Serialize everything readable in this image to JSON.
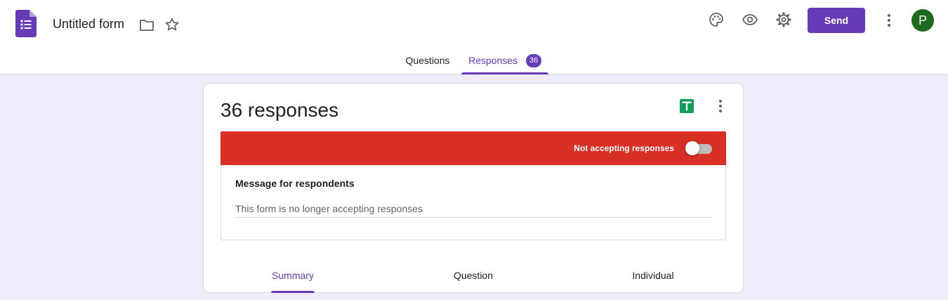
{
  "header": {
    "form_title": "Untitled form",
    "send_label": "Send",
    "avatar_initial": "P",
    "icons": [
      "forms-logo-icon",
      "folder-icon",
      "star-icon",
      "palette-icon",
      "eye-icon",
      "gear-icon",
      "more-vert-icon"
    ]
  },
  "tabs": {
    "questions_label": "Questions",
    "responses_label": "Responses",
    "responses_badge": "36"
  },
  "card": {
    "title": "36 responses",
    "accepting_label": "Not accepting responses",
    "accepting_on": false,
    "message_label": "Message for respondents",
    "message_value": "This form is no longer accepting responses",
    "subtabs": {
      "summary": "Summary",
      "question": "Question",
      "individual": "Individual"
    }
  },
  "colors": {
    "accent": "#673ab7",
    "background": "#f0ebf8",
    "closed_banner": "#d93025",
    "sheets_green": "#0f9d58"
  }
}
